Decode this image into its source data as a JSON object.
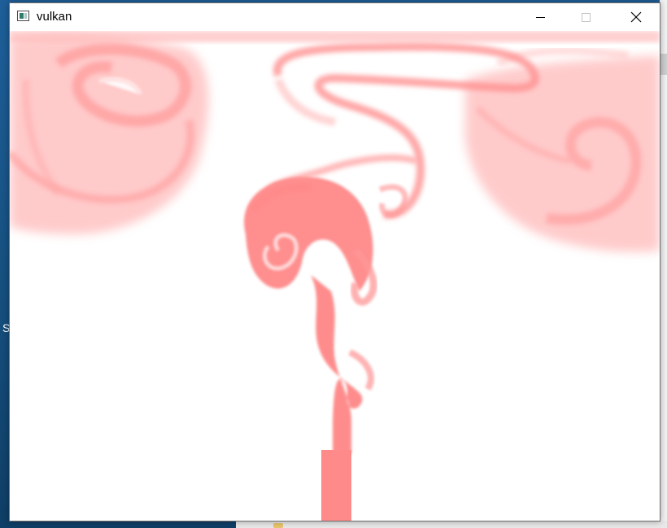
{
  "desktop": {
    "left_edge_text": "S"
  },
  "window": {
    "title": "vulkan",
    "icon": "app-window-icon",
    "controls": {
      "minimize_icon": "minimize-icon",
      "maximize_icon": "maximize-icon",
      "close_icon": "close-icon"
    }
  },
  "render": {
    "content": "fluid-smoke-simulation",
    "colors": {
      "dye": "#ff8a8a",
      "dye_light": "#ffd6d6",
      "background": "#ffffff"
    }
  }
}
